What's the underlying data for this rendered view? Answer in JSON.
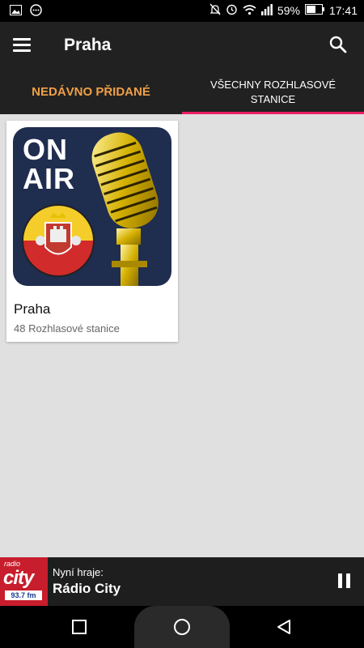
{
  "status_bar": {
    "battery": "59%",
    "time": "17:41",
    "icons": [
      "image-notification-icon",
      "messenger-icon",
      "mute-icon",
      "alarm-icon",
      "wifi-icon",
      "signal-icon",
      "battery-icon"
    ]
  },
  "app_bar": {
    "title": "Praha",
    "icons": [
      "menu-icon",
      "search-icon"
    ]
  },
  "tabs": [
    {
      "label": "NEDÁVNO PŘIDANÉ"
    },
    {
      "label": "VŠECHNY ROZHLASOVÉ STANICE",
      "selected": true
    }
  ],
  "cards": [
    {
      "image_text": [
        "ON",
        "AIR"
      ],
      "title": "Praha",
      "subtitle": "48 Rozhlasové stanice"
    }
  ],
  "player": {
    "logo": {
      "top": "radio",
      "main": "city",
      "freq": "93.7 fm"
    },
    "label": "Nyní hraje:",
    "station": "Rádio City"
  },
  "colors": {
    "appbar": "#212121",
    "tab_active_text": "#f0a046",
    "tab_indicator": "#e91e63",
    "content_bg": "#e0e0e0"
  }
}
